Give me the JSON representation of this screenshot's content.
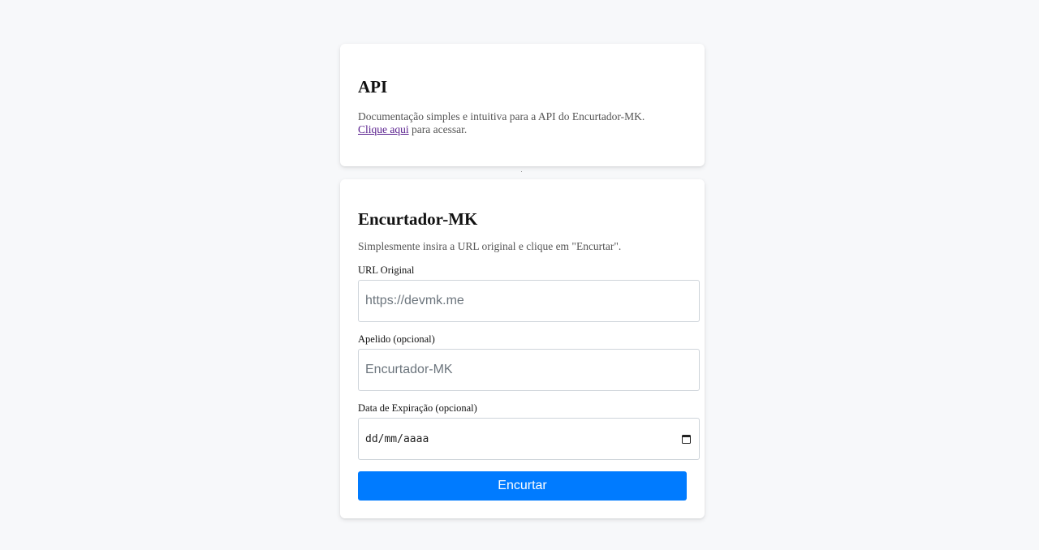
{
  "api_card": {
    "title": "API",
    "description_prefix": "Documentação simples e intuitiva para a API do Encurtador-MK.",
    "link_text": "Clique aqui",
    "description_suffix": " para acessar."
  },
  "form_card": {
    "title": "Encurtador-MK",
    "description": "Simplesmente insira a URL original e clique em \"Encurtar\".",
    "url_field": {
      "label": "URL Original",
      "placeholder": "https://devmk.me",
      "value": ""
    },
    "alias_field": {
      "label": "Apelido (opcional)",
      "placeholder": "Encurtador-MK",
      "value": ""
    },
    "date_field": {
      "label": "Data de Expiração (opcional)",
      "placeholder": "dd/mm/aaaa",
      "icon": "calendar-icon"
    },
    "submit_label": "Encurtar"
  },
  "colors": {
    "background": "#f7f8fa",
    "card": "#ffffff",
    "primary": "#007bff",
    "link": "#551a8b"
  }
}
